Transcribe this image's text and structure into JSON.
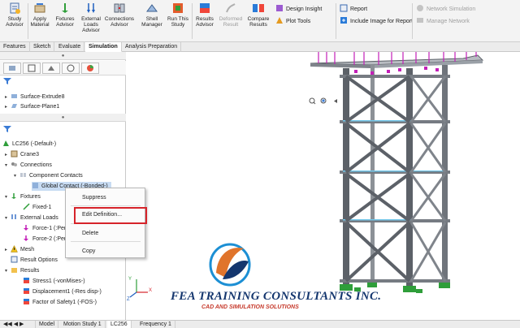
{
  "ribbon": {
    "buttons": [
      {
        "label": "Study Advisor"
      },
      {
        "label": "Apply Material"
      },
      {
        "label": "Fixtures Advisor"
      },
      {
        "label": "External Loads Advisor"
      },
      {
        "label": "Connections Advisor"
      },
      {
        "label": "Shell Manager"
      },
      {
        "label": "Run This Study"
      },
      {
        "label": "Results Advisor"
      },
      {
        "label": "Deformed Result"
      },
      {
        "label": "Compare Results"
      }
    ],
    "small": {
      "design_insight": "Design Insight",
      "plot_tools": "Plot Tools",
      "report": "Report",
      "include_image": "Include Image for Report",
      "network_simulation": "Network Simulation",
      "manage_network": "Manage Network"
    }
  },
  "tabs": [
    "Features",
    "Sketch",
    "Evaluate",
    "Simulation",
    "Analysis Preparation"
  ],
  "tree_top": [
    "Surface-Extrude8",
    "Surface-Plane1"
  ],
  "tree": {
    "study": "LC256 (-Default-)",
    "crane": "Crane3",
    "connections": "Connections",
    "component_contacts": "Component Contacts",
    "global_contact": "Global Contact (-Bonded-)",
    "fixtures": "Fixtures",
    "fixed": "Fixed-1",
    "external_loads": "External Loads",
    "force1": "Force-1 (:Per",
    "force2": "Force-2 (:Per",
    "mesh": "Mesh",
    "result_options": "Result Options",
    "results": "Results",
    "stress": "Stress1 (-vonMises-)",
    "displacement": "Displacement1 (-Res disp-)",
    "fos": "Factor of Safety1 (-FOS-)"
  },
  "context_menu": {
    "suppress": "Suppress",
    "edit_definition": "Edit Definition...",
    "delete": "Delete",
    "copy": "Copy"
  },
  "bottom_tabs": [
    "Model",
    "Motion Study 1",
    "LC256",
    "Frequency 1"
  ],
  "logo": {
    "title": "FEA TRAINING CONSULTANTS INC.",
    "subtitle": "CAD AND SIMULATION SOLUTIONS"
  },
  "colors": {
    "structure": "#5c6168",
    "fixture": "#2f9e3a",
    "load": "#c31fb8",
    "highlight": "#d6232a",
    "logo_blue": "#14366e",
    "logo_orange": "#e0742b"
  }
}
